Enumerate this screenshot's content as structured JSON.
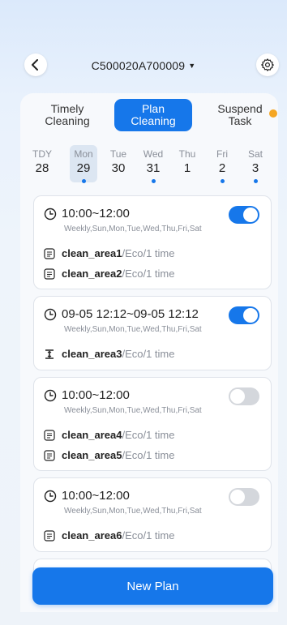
{
  "header": {
    "device_id": "C500020A700009"
  },
  "tabs": [
    {
      "line1": "Timely",
      "line2": "Cleaning"
    },
    {
      "line1": "Plan",
      "line2": "Cleaning"
    },
    {
      "line1": "Suspend",
      "line2": "Task"
    }
  ],
  "week": [
    {
      "name": "TDY",
      "date": "28",
      "marked": false
    },
    {
      "name": "Mon",
      "date": "29",
      "marked": true,
      "selected": true
    },
    {
      "name": "Tue",
      "date": "30",
      "marked": false
    },
    {
      "name": "Wed",
      "date": "31",
      "marked": true
    },
    {
      "name": "Thu",
      "date": "1",
      "marked": false
    },
    {
      "name": "Fri",
      "date": "2",
      "marked": true
    },
    {
      "name": "Sat",
      "date": "3",
      "marked": true
    }
  ],
  "plans": [
    {
      "time": "10:00~12:00",
      "repeat": "Weekly,Sun,Mon,Tue,Wed,Thu,Fri,Sat",
      "enabled": true,
      "areas": [
        {
          "name": "clean_area1",
          "detail": "/Eco/1 time",
          "icon": "list-icon"
        },
        {
          "name": "clean_area2",
          "detail": "/Eco/1 time",
          "icon": "list-icon"
        }
      ]
    },
    {
      "time": "09-05 12:12~09-05 12:12",
      "repeat": "Weekly,Sun,Mon,Tue,Wed,Thu,Fri,Sat",
      "enabled": true,
      "areas": [
        {
          "name": "clean_area3",
          "detail": "/Eco/1 time",
          "icon": "escalator-icon"
        }
      ]
    },
    {
      "time": "10:00~12:00",
      "repeat": "Weekly,Sun,Mon,Tue,Wed,Thu,Fri,Sat",
      "enabled": false,
      "areas": [
        {
          "name": "clean_area4",
          "detail": "/Eco/1 time",
          "icon": "list-icon"
        },
        {
          "name": "clean_area5",
          "detail": "/Eco/1 time",
          "icon": "list-icon"
        }
      ]
    },
    {
      "time": "10:00~12:00",
      "repeat": "Weekly,Sun,Mon,Tue,Wed,Thu,Fri,Sat",
      "enabled": false,
      "areas": [
        {
          "name": "clean_area6",
          "detail": "/Eco/1 time",
          "icon": "list-icon"
        }
      ]
    }
  ],
  "new_plan_label": "New Plan",
  "colors": {
    "accent": "#1677ea",
    "badge": "#f5a623",
    "toggle_off": "#d4d7dc"
  }
}
